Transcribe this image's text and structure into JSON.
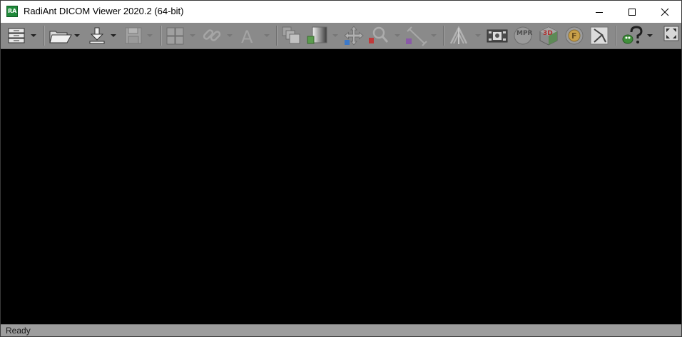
{
  "window": {
    "title": "RadiAnt DICOM Viewer 2020.2 (64-bit)",
    "app_icon_text": "RA",
    "controls": [
      "minimize",
      "maximize",
      "close"
    ]
  },
  "toolbar": {
    "buttons": [
      {
        "name": "database-icon",
        "has_dropdown": true
      },
      {
        "name": "open-folder-icon",
        "has_dropdown": true
      },
      {
        "name": "download-icon",
        "has_dropdown": true
      },
      {
        "name": "save-icon",
        "has_dropdown": true
      },
      {
        "name": "layout-grid-icon",
        "has_dropdown": true
      },
      {
        "name": "link-icon",
        "has_dropdown": true
      },
      {
        "name": "annotation-text-icon",
        "has_dropdown": true
      },
      {
        "name": "series-compare-icon",
        "has_dropdown": false
      },
      {
        "name": "window-level-icon",
        "has_dropdown": true
      },
      {
        "name": "pan-icon",
        "has_dropdown": false
      },
      {
        "name": "zoom-icon",
        "has_dropdown": true
      },
      {
        "name": "measure-icon",
        "has_dropdown": true
      },
      {
        "name": "scout-lines-icon",
        "has_dropdown": true
      },
      {
        "name": "cine-icon",
        "has_dropdown": false
      },
      {
        "name": "mpr-icon",
        "has_dropdown": false
      },
      {
        "name": "3d-icon",
        "has_dropdown": false
      },
      {
        "name": "fusion-icon",
        "has_dropdown": false
      },
      {
        "name": "curved-mpr-icon",
        "has_dropdown": false
      },
      {
        "name": "help-icon",
        "has_dropdown": true
      },
      {
        "name": "fullscreen-icon",
        "has_dropdown": false
      }
    ],
    "mpr_icon_label": "MPR",
    "three_d_label": "3D",
    "fusion_label": "F",
    "text_tool_label": "A"
  },
  "status": {
    "text": "Ready"
  },
  "colors": {
    "titlebar_bg": "#ffffff",
    "toolbar_bg": "#8a8a8a",
    "canvas_bg": "#000000",
    "statusbar_bg": "#9d9d9d"
  }
}
